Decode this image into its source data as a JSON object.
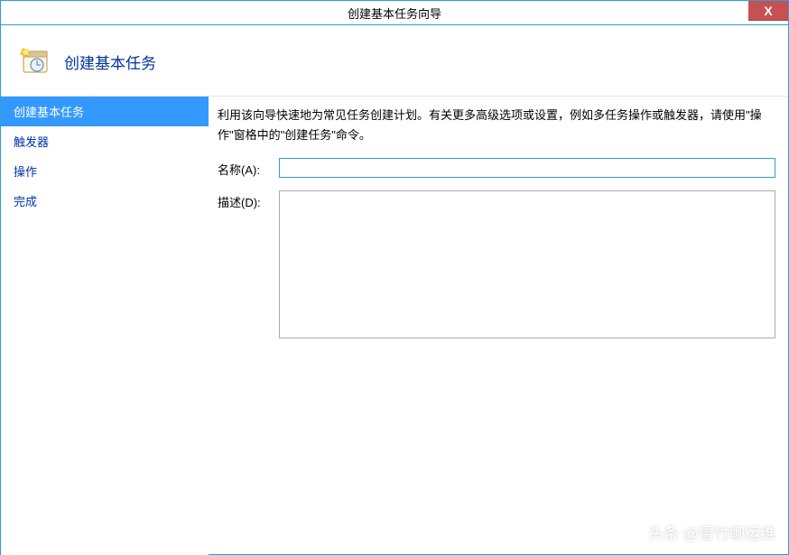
{
  "titlebar": {
    "title": "创建基本任务向导",
    "close": "X"
  },
  "header": {
    "title": "创建基本任务"
  },
  "sidebar": {
    "items": [
      {
        "label": "创建基本任务",
        "selected": true
      },
      {
        "label": "触发器",
        "selected": false
      },
      {
        "label": "操作",
        "selected": false
      },
      {
        "label": "完成",
        "selected": false
      }
    ]
  },
  "main": {
    "instruction": "利用该向导快速地为常见任务创建计划。有关更多高级选项或设置，例如多任务操作或触发器，请使用\"操作\"窗格中的\"创建任务\"命令。",
    "name_label": "名称(A):",
    "name_value": "",
    "desc_label": "描述(D):",
    "desc_value": ""
  },
  "watermark": {
    "text": "头条 @雪竹聊运维"
  }
}
